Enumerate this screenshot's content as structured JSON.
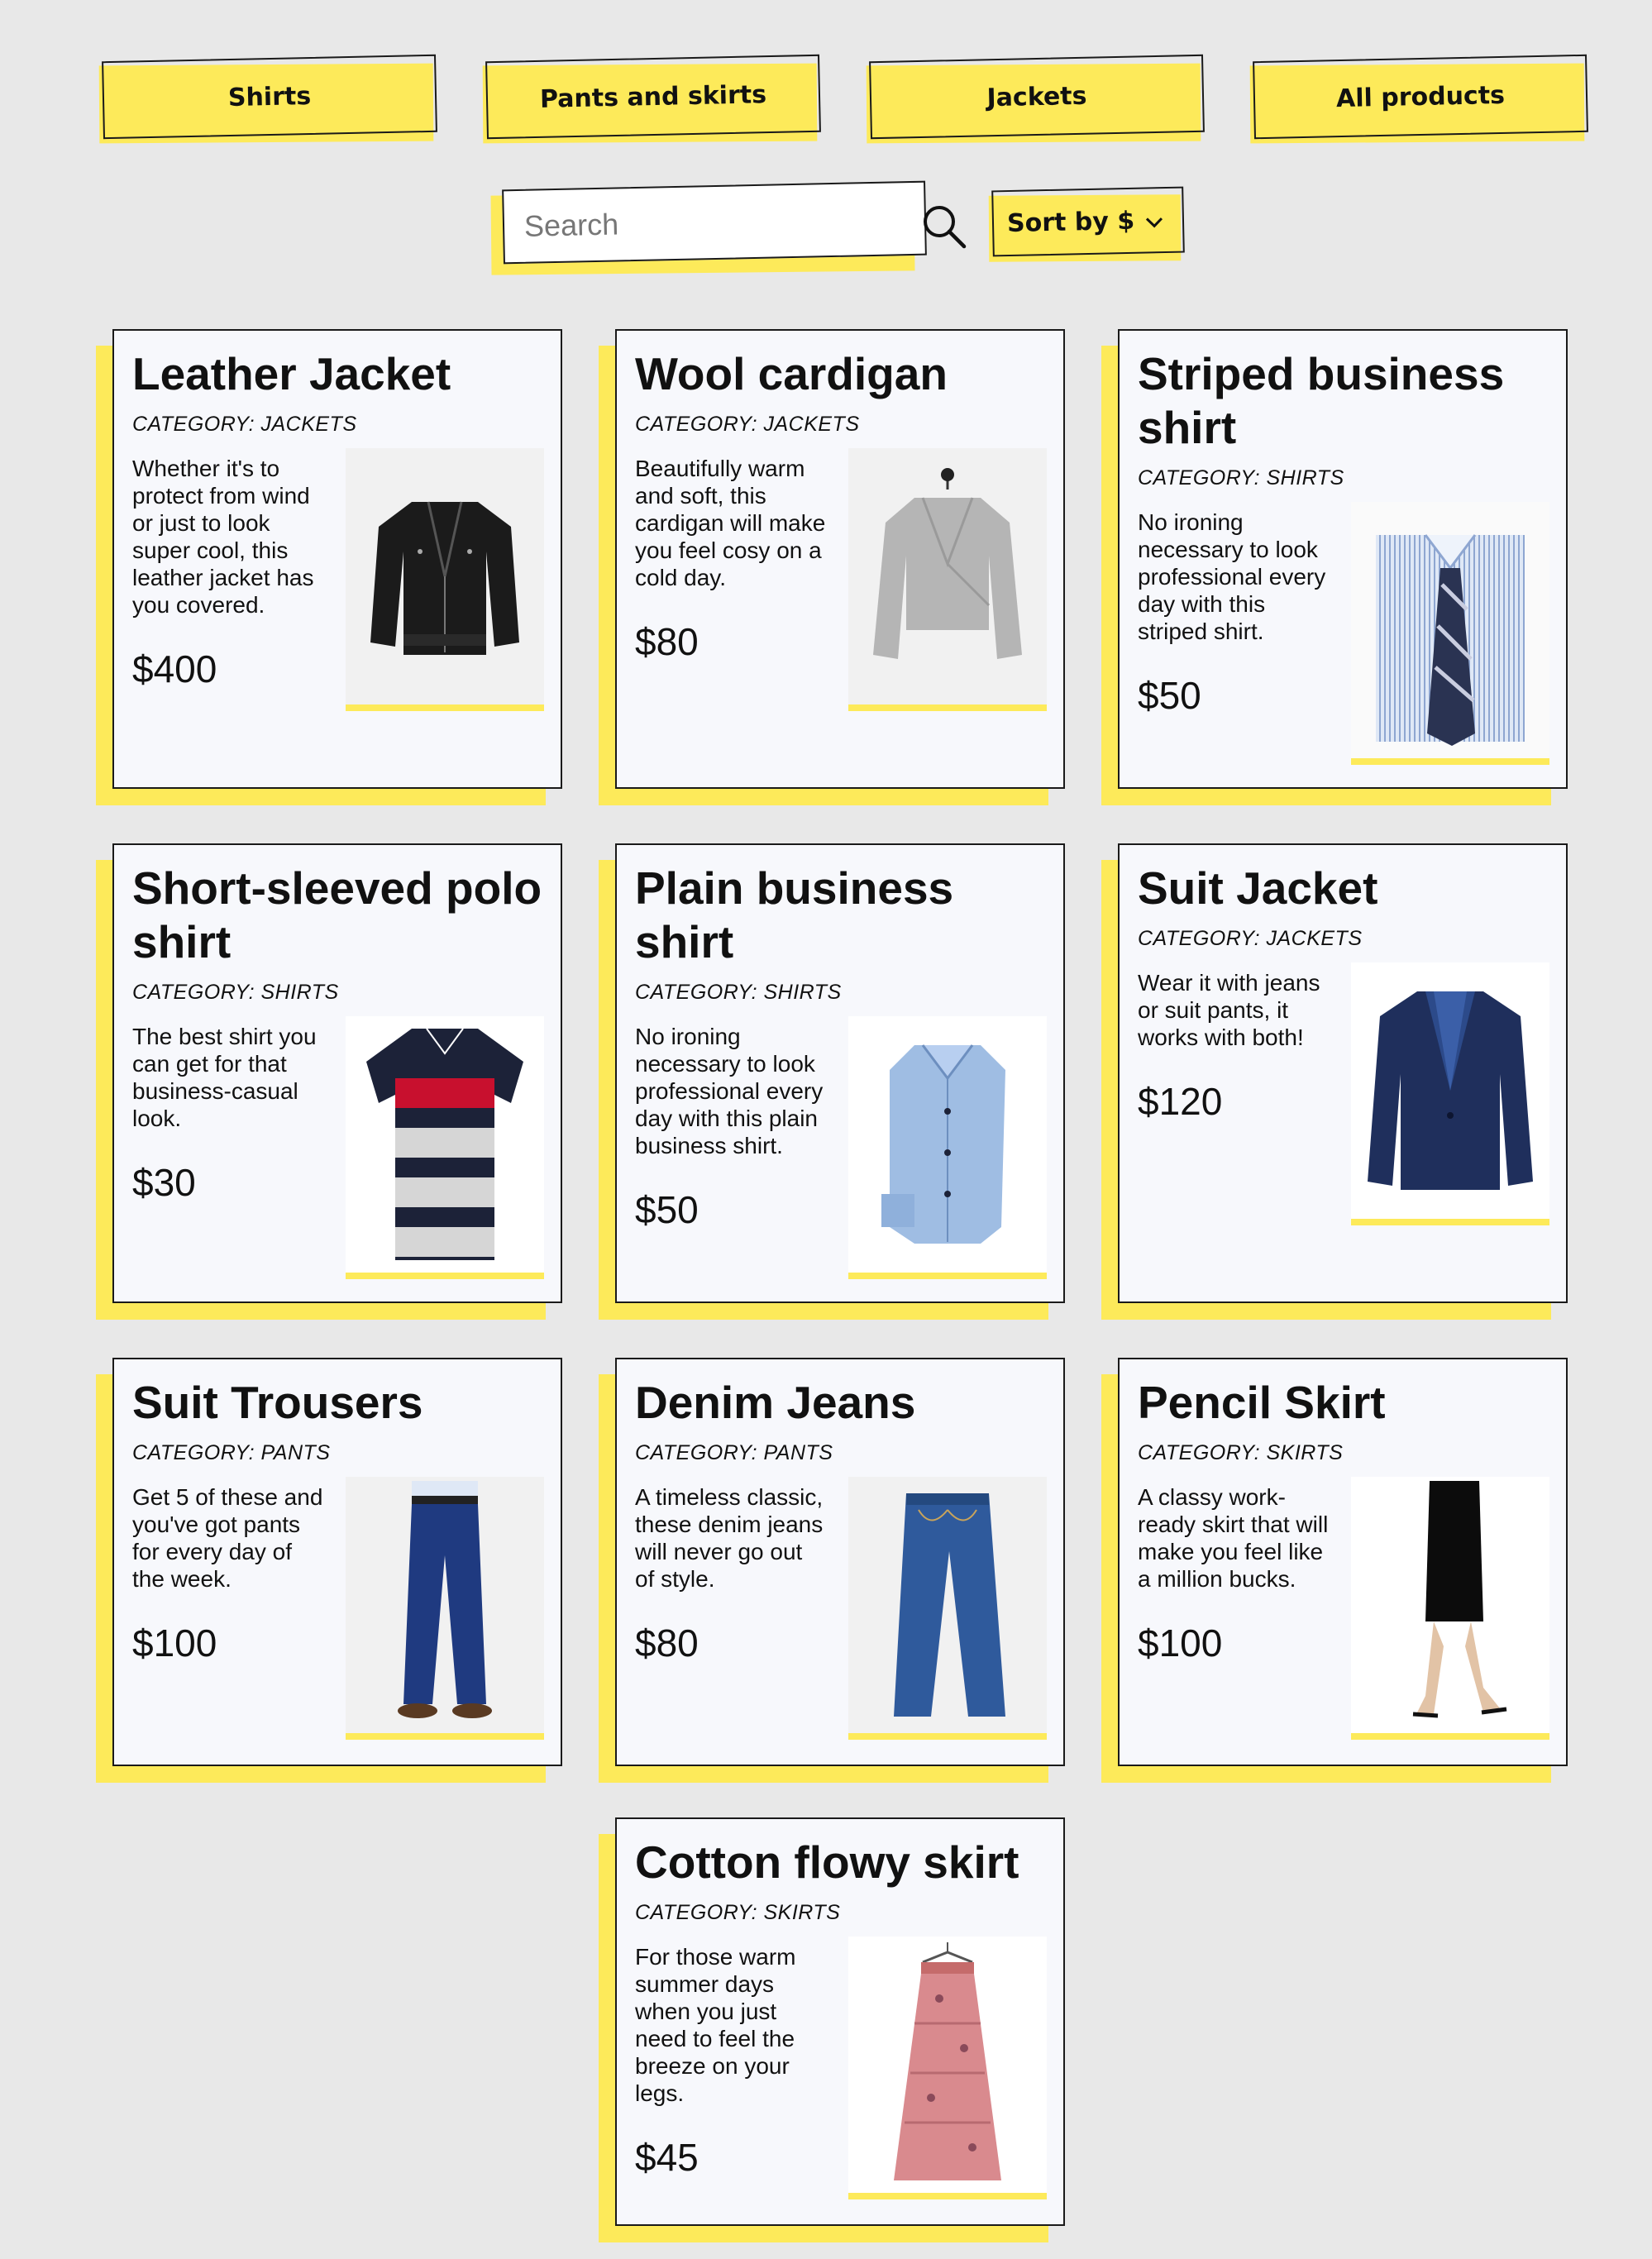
{
  "nav": {
    "categories": [
      "Shirts",
      "Pants and skirts",
      "Jackets",
      "All products"
    ]
  },
  "search": {
    "placeholder": "Search"
  },
  "sort": {
    "label": "Sort by $"
  },
  "colors": {
    "accent": "#fdea5a",
    "background": "#e8e8e8",
    "card": "#f7f8fc"
  },
  "products": [
    {
      "title": "Leather Jacket",
      "category": "CATEGORY: JACKETS",
      "description": "Whether it's to protect from wind or just to look super cool, this leather jacket has you covered.",
      "price": "$400",
      "icon": "leather-jacket-icon"
    },
    {
      "title": "Wool cardigan",
      "category": "CATEGORY: JACKETS",
      "description": "Beautifully warm and soft, this cardigan will make you feel cosy on a cold day.",
      "price": "$80",
      "icon": "cardigan-icon"
    },
    {
      "title": "Striped business shirt",
      "category": "CATEGORY: SHIRTS",
      "description": "No ironing necessary to look professional every day with this striped shirt.",
      "price": "$50",
      "icon": "striped-shirt-icon"
    },
    {
      "title": "Short-sleeved polo shirt",
      "category": "CATEGORY: SHIRTS",
      "description": "The best shirt you can get for that business-casual look.",
      "price": "$30",
      "icon": "polo-shirt-icon"
    },
    {
      "title": "Plain business shirt",
      "category": "CATEGORY: SHIRTS",
      "description": "No ironing necessary to look professional every day with this plain business shirt.",
      "price": "$50",
      "icon": "plain-shirt-icon"
    },
    {
      "title": "Suit Jacket",
      "category": "CATEGORY: JACKETS",
      "description": "Wear it with jeans or suit pants, it works with both!",
      "price": "$120",
      "icon": "suit-jacket-icon"
    },
    {
      "title": "Suit Trousers",
      "category": "CATEGORY: PANTS",
      "description": "Get 5 of these and you've got pants for every day of the week.",
      "price": "$100",
      "icon": "suit-trousers-icon"
    },
    {
      "title": "Denim Jeans",
      "category": "CATEGORY: PANTS",
      "description": "A timeless classic, these denim jeans will never go out of style.",
      "price": "$80",
      "icon": "jeans-icon"
    },
    {
      "title": "Pencil Skirt",
      "category": "CATEGORY: SKIRTS",
      "description": "A classy work-ready skirt that will make you feel like a million bucks.",
      "price": "$100",
      "icon": "pencil-skirt-icon"
    },
    {
      "title": "Cotton flowy skirt",
      "category": "CATEGORY: SKIRTS",
      "description": "For those warm summer days when you just need to feel the breeze on your legs.",
      "price": "$45",
      "icon": "flowy-skirt-icon"
    }
  ]
}
